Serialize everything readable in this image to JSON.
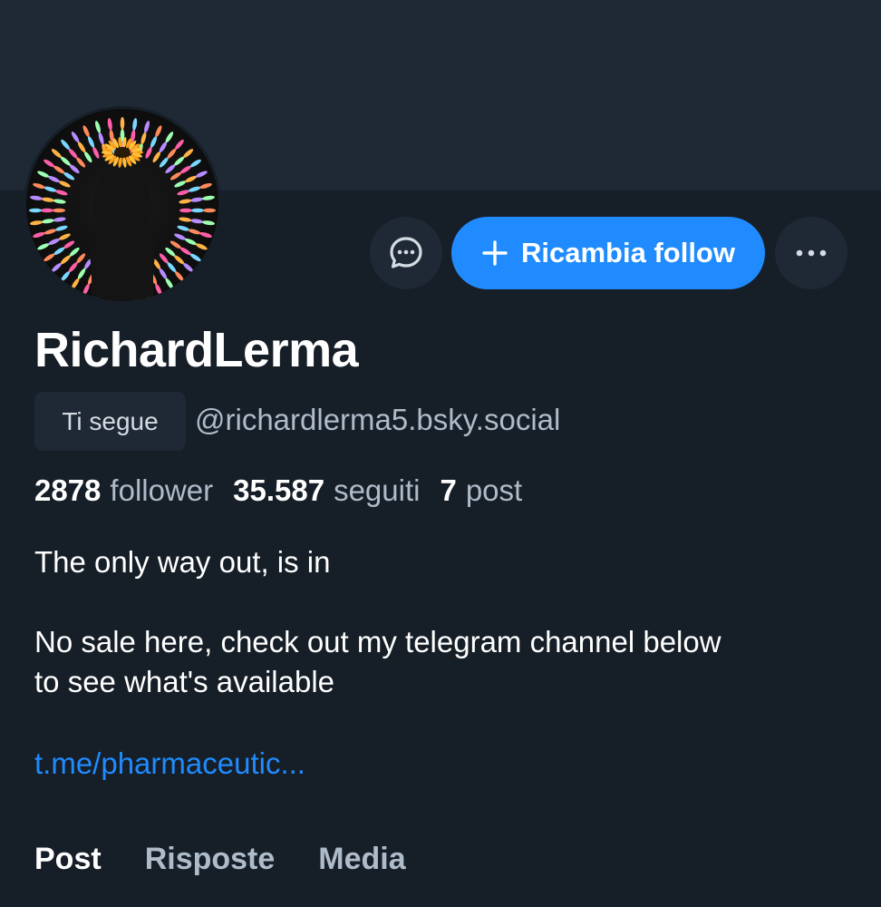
{
  "profile": {
    "display_name": "RichardLerma",
    "follows_you_badge": "Ti segue",
    "handle": "@richardlerma5.bsky.social",
    "avatar_icon": "psychedelic-silhouette-avatar"
  },
  "actions": {
    "message_icon": "chat-bubble-icon",
    "follow_label": "Ricambia follow",
    "follow_icon": "plus-icon",
    "more_icon": "ellipsis-icon"
  },
  "stats": {
    "followers_count": "2878",
    "followers_label": "follower",
    "following_count": "35.587",
    "following_label": "seguiti",
    "posts_count": "7",
    "posts_label": "post"
  },
  "bio": {
    "line1": "The only way out, is in",
    "line2": "No sale here, check out my telegram channel below",
    "line3": "to see what's available",
    "link": "t.me/pharmaceutic..."
  },
  "tabs": [
    {
      "label": "Post",
      "active": true
    },
    {
      "label": "Risposte",
      "active": false
    },
    {
      "label": "Media",
      "active": false
    }
  ],
  "colors": {
    "background": "#161e27",
    "banner": "#1e2935",
    "accent": "#208bfe",
    "muted_text": "#aebbc9"
  }
}
